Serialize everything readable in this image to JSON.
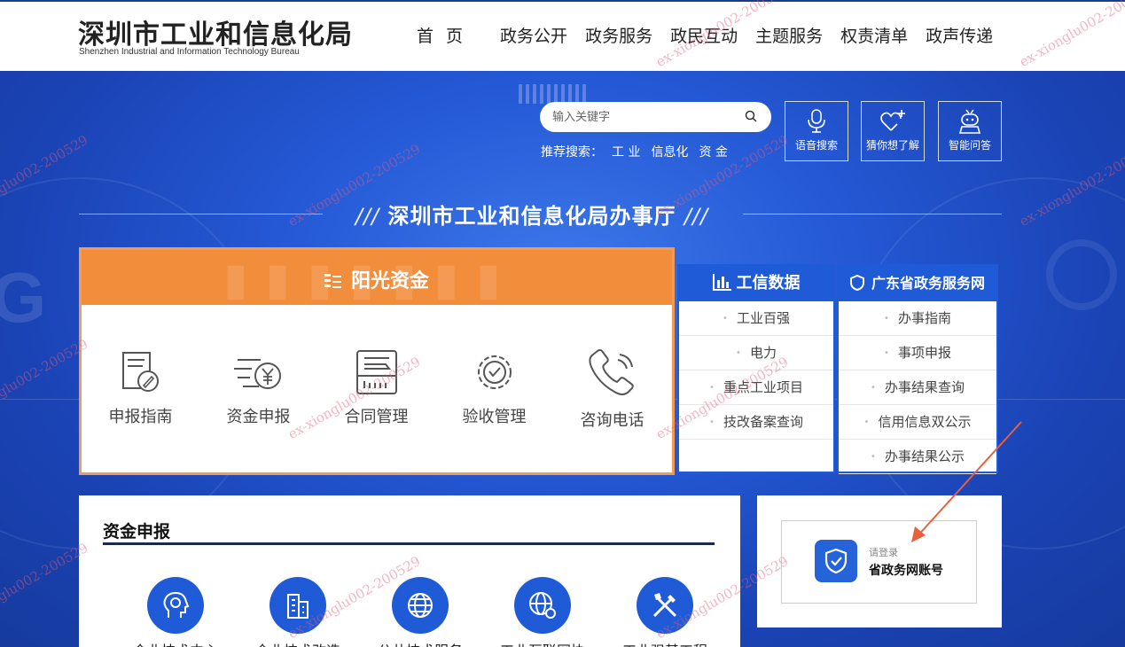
{
  "header": {
    "logo_cn": "深圳市工业和信息化局",
    "logo_en": "Shenzhen Industrial and Information Technology Bureau",
    "nav": [
      "首 页",
      "政务公开",
      "政务服务",
      "政民互动",
      "主题服务",
      "权责清单",
      "政声传递"
    ]
  },
  "search": {
    "placeholder": "输入关键字",
    "recommend_label": "推荐搜索：",
    "recommend": [
      "工 业",
      "信息化",
      "资 金"
    ]
  },
  "quick_buttons": [
    {
      "label": "语音搜索",
      "icon": "microphone-icon"
    },
    {
      "label": "猜你想了解",
      "icon": "heart-plus-icon"
    },
    {
      "label": "智能问答",
      "icon": "robot-icon"
    }
  ],
  "section_title": "深圳市工业和信息化局办事厅",
  "sunshine": {
    "title": "阳光资金",
    "items": [
      {
        "label": "申报指南",
        "icon": "document-pen-icon"
      },
      {
        "label": "资金申报",
        "icon": "yuan-coin-icon"
      },
      {
        "label": "合同管理",
        "icon": "contract-printer-icon"
      },
      {
        "label": "验收管理",
        "icon": "gear-check-icon"
      },
      {
        "label": "咨询电话",
        "icon": "phone-icon"
      }
    ]
  },
  "data_panel": {
    "title": "工信数据",
    "items": [
      "工业百强",
      "电力",
      "重点工业项目",
      "技改备案查询"
    ]
  },
  "gd_panel": {
    "title": "广东省政务服务网",
    "items": [
      "办事指南",
      "事项申报",
      "办事结果查询",
      "信用信息双公示",
      "办事结果公示"
    ]
  },
  "apply": {
    "title": "资金申报",
    "items": [
      "企业技术中心",
      "企业技术改造",
      "公共技术服务",
      "工业互联网协",
      "工业强基工程"
    ]
  },
  "login": {
    "sub": "请登录",
    "main": "省政务网账号"
  },
  "watermark": "ex-xionglu002-200529",
  "colors": {
    "brand_blue": "#1f5ad7",
    "orange": "#f28d3c",
    "arrow": "#e8613a"
  }
}
